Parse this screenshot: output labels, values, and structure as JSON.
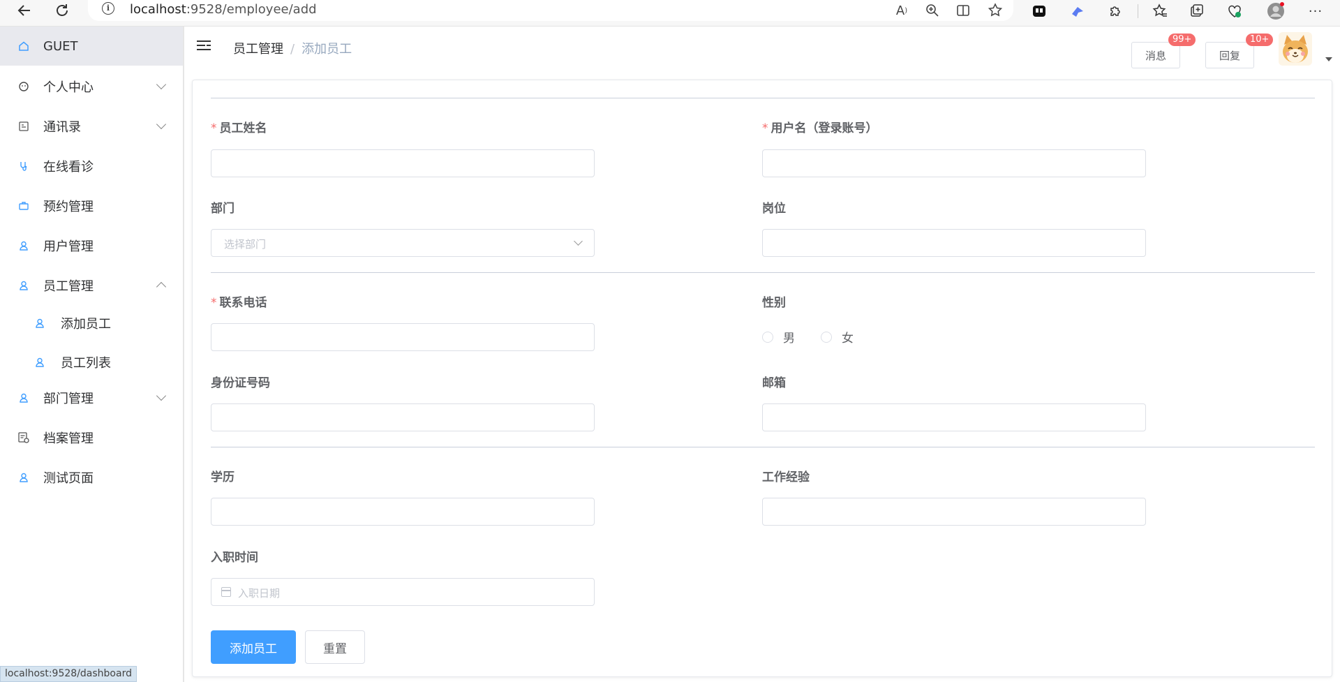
{
  "browser": {
    "url_host": "localhost",
    "url_path": ":9528/employee/add",
    "status_url": "localhost:9528/dashboard"
  },
  "sidebar": {
    "items": [
      {
        "label": "GUET",
        "icon": "home-icon"
      },
      {
        "label": "个人中心",
        "icon": "user-circle-icon"
      },
      {
        "label": "通讯录",
        "icon": "contacts-icon"
      },
      {
        "label": "在线看诊",
        "icon": "stethoscope-icon"
      },
      {
        "label": "预约管理",
        "icon": "briefcase-icon"
      },
      {
        "label": "用户管理",
        "icon": "user-icon"
      },
      {
        "label": "员工管理",
        "icon": "user-icon"
      },
      {
        "label": "添加员工",
        "icon": "user-icon"
      },
      {
        "label": "员工列表",
        "icon": "user-icon"
      },
      {
        "label": "部门管理",
        "icon": "user-icon"
      },
      {
        "label": "档案管理",
        "icon": "document-icon"
      },
      {
        "label": "测试页面",
        "icon": "user-icon"
      }
    ]
  },
  "header": {
    "breadcrumb_parent": "员工管理",
    "breadcrumb_separator": "/",
    "breadcrumb_current": "添加员工",
    "messages_label": "消息",
    "messages_badge": "99+",
    "replies_label": "回复",
    "replies_badge": "10+"
  },
  "form": {
    "name_label": "员工姓名",
    "username_label": "用户名（登录账号）",
    "department_label": "部门",
    "department_placeholder": "选择部门",
    "position_label": "岗位",
    "phone_label": "联系电话",
    "gender_label": "性别",
    "gender_male": "男",
    "gender_female": "女",
    "idcard_label": "身份证号码",
    "email_label": "邮箱",
    "education_label": "学历",
    "experience_label": "工作经验",
    "hire_date_label": "入职时间",
    "hire_date_placeholder": "入职日期",
    "required_mark": "*",
    "submit_label": "添加员工",
    "reset_label": "重置"
  },
  "colors": {
    "primary": "#409eff",
    "badge": "#f56c6c",
    "required": "#f56c6c"
  }
}
